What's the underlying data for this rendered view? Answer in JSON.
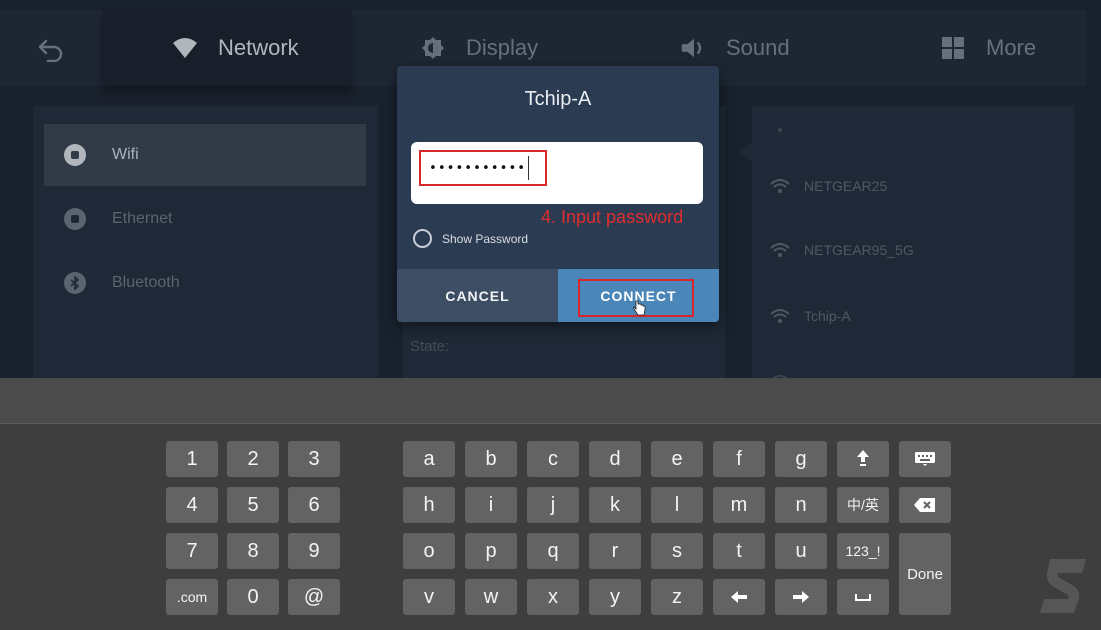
{
  "tabs": [
    {
      "label": "Network",
      "icon": "wifi-icon"
    },
    {
      "label": "Display",
      "icon": "brightness-icon"
    },
    {
      "label": "Sound",
      "icon": "speaker-icon"
    },
    {
      "label": "More",
      "icon": "grid-icon"
    }
  ],
  "sidebar": {
    "items": [
      {
        "label": "Wifi",
        "icon": "wifi-icon"
      },
      {
        "label": "Ethernet",
        "icon": "ethernet-icon"
      },
      {
        "label": "Bluetooth",
        "icon": "bluetooth-icon"
      }
    ]
  },
  "details": {
    "state_label": "State:"
  },
  "wifi_list": {
    "networks": [
      "NETGEAR25",
      "NETGEAR95_5G",
      "Tchip-A"
    ]
  },
  "dialog": {
    "title": "Tchip-A",
    "password_value": "•••••••••••",
    "annotation": "4. Input password",
    "show_password_label": "Show Password",
    "cancel_label": "CANCEL",
    "connect_label": "CONNECT"
  },
  "keyboard": {
    "numpad": [
      "1",
      "2",
      "3",
      "4",
      "5",
      "6",
      "7",
      "8",
      "9",
      ".com",
      "0",
      "@"
    ],
    "row1": [
      "a",
      "b",
      "c",
      "d",
      "e",
      "f",
      "g"
    ],
    "row2": [
      "h",
      "i",
      "j",
      "k",
      "l",
      "m",
      "n",
      "中/英"
    ],
    "row3": [
      "o",
      "p",
      "q",
      "r",
      "s",
      "t",
      "u",
      "123_!"
    ],
    "row4": [
      "v",
      "w",
      "x",
      "y",
      "z"
    ],
    "done_label": "Done"
  },
  "colors": {
    "accent": "#4a86b8",
    "highlight_red": "#d9262a",
    "background": "#1c2532"
  }
}
